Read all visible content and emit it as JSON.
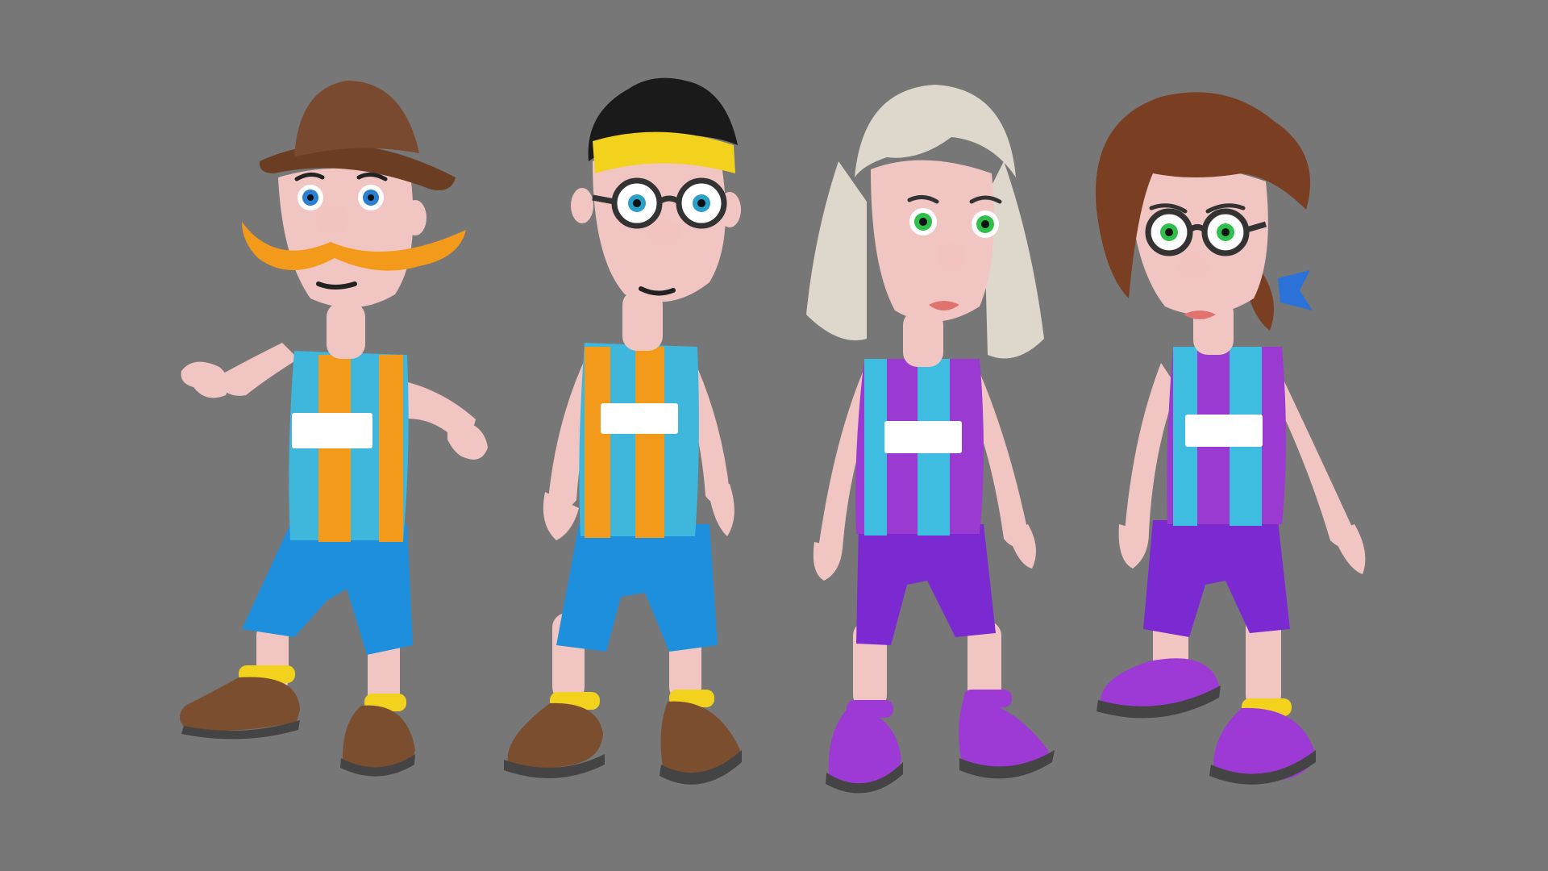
{
  "scene": {
    "background": "#777777",
    "skin": "#f1c6c2",
    "skin_shade": "#dca7a6",
    "characters": [
      {
        "name": "mustache-man",
        "hat": "brown-fedora",
        "mustache": true,
        "glasses": false,
        "eye_color": "#2a7fd3",
        "hair_color": "#7a4a30",
        "stripe_a": "#3fb6dc",
        "stripe_b": "#f39a1a",
        "shorts_color": "#1e8fdc",
        "shoe_color": "#7a4e2e",
        "cuff_color": "#f2d21c"
      },
      {
        "name": "headband-boy",
        "headband": "#f2d21c",
        "mustache": false,
        "glasses": true,
        "eye_color": "#2aa0c8",
        "hair_color": "#1a1a1a",
        "stripe_a": "#3fb6dc",
        "stripe_b": "#f39a1a",
        "shorts_color": "#1e8fdc",
        "shoe_color": "#7a4e2e",
        "cuff_color": "#f2d21c"
      },
      {
        "name": "blonde-woman",
        "mustache": false,
        "glasses": false,
        "eye_color": "#2ec04a",
        "hair_color": "#ded8cc",
        "stripe_a": "#9b3ad0",
        "stripe_b": "#3fbde0",
        "shorts_color": "#7a2ad0",
        "shoe_color": "#9d3ad6",
        "cuff_color": "#9d3ad6"
      },
      {
        "name": "brunette-woman",
        "mustache": false,
        "glasses": true,
        "ribbon": "#2a72d8",
        "eye_color": "#2ec04a",
        "hair_color": "#7a3e22",
        "stripe_a": "#9b3ad0",
        "stripe_b": "#3fbde0",
        "shorts_color": "#7a2ad0",
        "shoe_color": "#9d3ad6",
        "cuff_color": "#f2d21c"
      }
    ]
  }
}
